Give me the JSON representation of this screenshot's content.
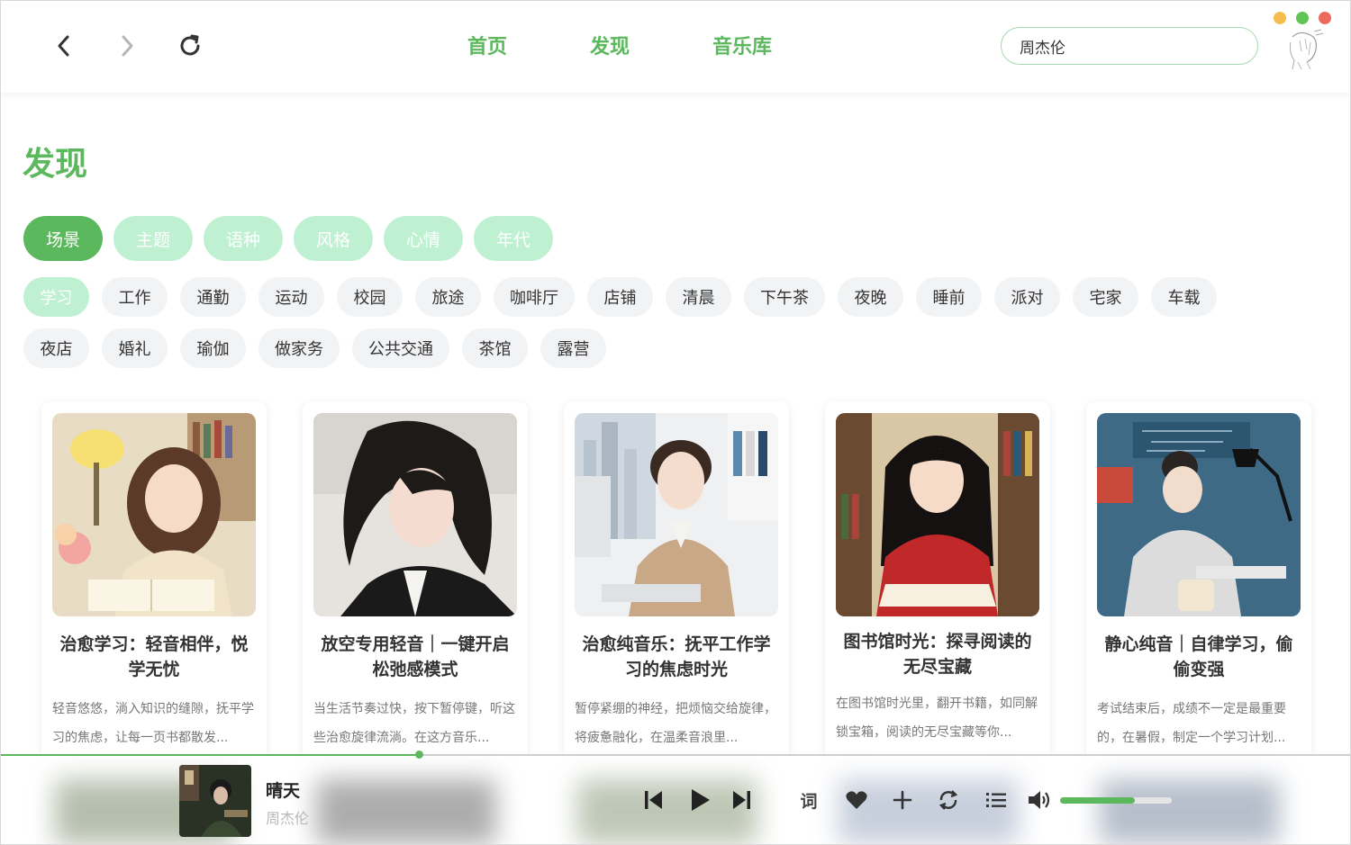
{
  "window": {
    "traffic_colors": [
      "#f5bd4f",
      "#61c554",
      "#ed6a5e"
    ]
  },
  "nav": {
    "back_icon": "chevron-left-icon",
    "forward_icon": "chevron-right-icon",
    "refresh_icon": "refresh-icon",
    "tabs": [
      {
        "label": "首页"
      },
      {
        "label": "发现"
      },
      {
        "label": "音乐库"
      }
    ],
    "search_value": "周杰伦"
  },
  "page": {
    "title": "发现",
    "categories": [
      {
        "label": "场景",
        "active": true
      },
      {
        "label": "主题"
      },
      {
        "label": "语种"
      },
      {
        "label": "风格"
      },
      {
        "label": "心情"
      },
      {
        "label": "年代"
      }
    ],
    "tags": [
      {
        "label": "学习",
        "active": true
      },
      {
        "label": "工作"
      },
      {
        "label": "通勤"
      },
      {
        "label": "运动"
      },
      {
        "label": "校园"
      },
      {
        "label": "旅途"
      },
      {
        "label": "咖啡厅"
      },
      {
        "label": "店铺"
      },
      {
        "label": "清晨"
      },
      {
        "label": "下午茶"
      },
      {
        "label": "夜晚"
      },
      {
        "label": "睡前"
      },
      {
        "label": "派对"
      },
      {
        "label": "宅家"
      },
      {
        "label": "车载"
      },
      {
        "label": "夜店"
      },
      {
        "label": "婚礼"
      },
      {
        "label": "瑜伽"
      },
      {
        "label": "做家务"
      },
      {
        "label": "公共交通"
      },
      {
        "label": "茶馆"
      },
      {
        "label": "露营"
      }
    ],
    "playlists": [
      {
        "title": "治愈学习：轻音相伴，悦学无忧",
        "desc": "轻音悠悠，淌入知识的缝隙，抚平学习的焦虑，让每一页书都散发..."
      },
      {
        "title": "放空专用轻音｜一键开启松弛感模式",
        "desc": "当生活节奏过快，按下暂停键，听这些治愈旋律流淌。在这方音乐..."
      },
      {
        "title": "治愈纯音乐：抚平工作学习的焦虑时光",
        "desc": "暂停紧绷的神经，把烦恼交给旋律，将疲惫融化，在温柔音浪里..."
      },
      {
        "title": "图书馆时光：探寻阅读的无尽宝藏",
        "desc": "在图书馆时光里，翻开书籍，如同解锁宝箱，阅读的无尽宝藏等你..."
      },
      {
        "title": "静心纯音｜自律学习，偷偷变强",
        "desc": "考试结束后，成绩不一定是最重要的，在暑假，制定一个学习计划..."
      }
    ]
  },
  "player": {
    "song_title": "晴天",
    "artist": "周杰伦",
    "progress": 0.31,
    "volume": 0.67,
    "lyric_label": "词",
    "icons": [
      "skip-back-icon",
      "play-icon",
      "skip-forward-icon",
      "heart-icon",
      "plus-icon",
      "repeat-icon",
      "playlist-icon",
      "volume-icon"
    ],
    "accent": "#5bb85d"
  }
}
